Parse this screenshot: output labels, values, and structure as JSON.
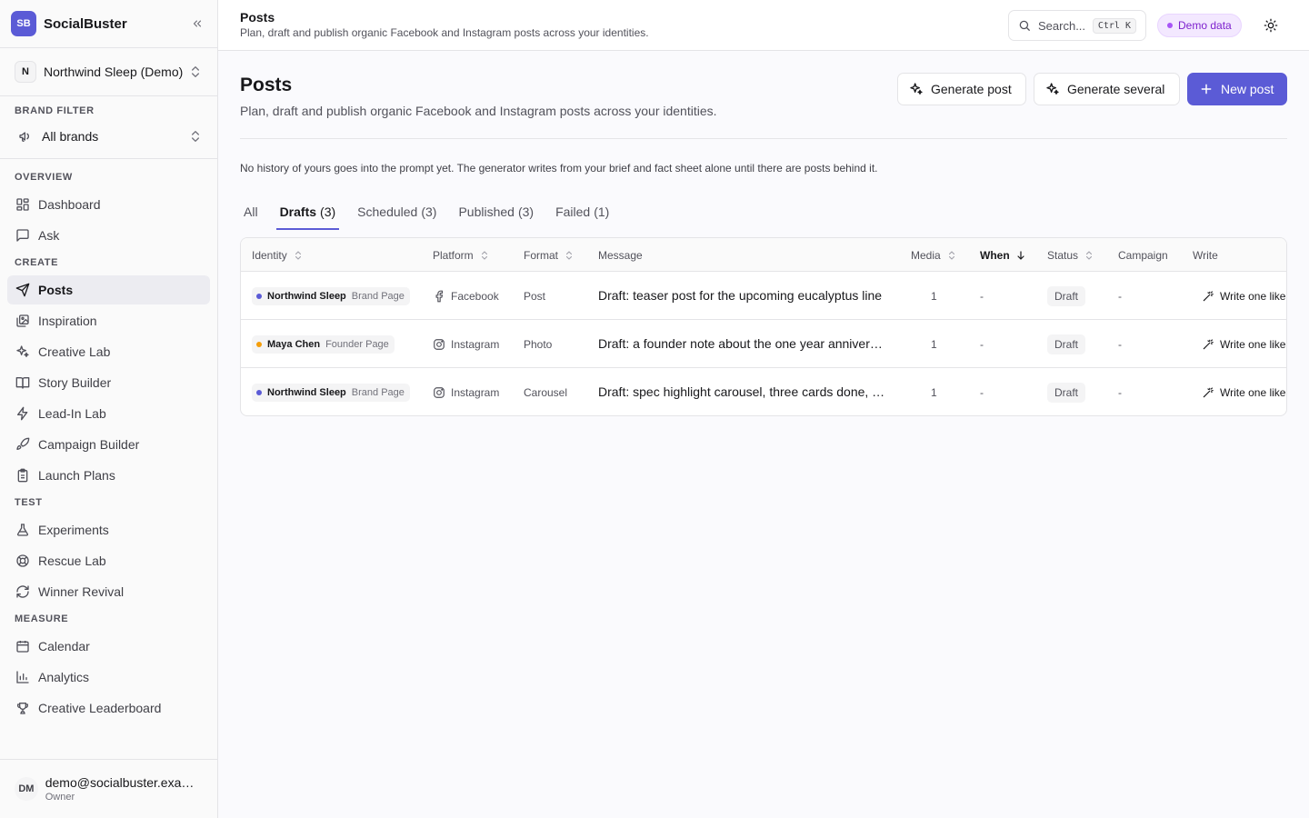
{
  "app": {
    "logo": "SB",
    "name": "SocialBuster"
  },
  "org": {
    "avatar": "N",
    "name": "Northwind Sleep (Demo)"
  },
  "brand_filter": {
    "label": "Brand filter",
    "value": "All brands"
  },
  "nav": {
    "overview": {
      "label": "Overview",
      "items": [
        {
          "label": "Dashboard",
          "icon": "dashboard-icon"
        },
        {
          "label": "Ask",
          "icon": "chat-icon"
        }
      ]
    },
    "create": {
      "label": "Create",
      "items": [
        {
          "label": "Posts",
          "icon": "send-icon"
        },
        {
          "label": "Inspiration",
          "icon": "gallery-icon"
        },
        {
          "label": "Creative Lab",
          "icon": "sparkles-icon"
        },
        {
          "label": "Story Builder",
          "icon": "book-icon"
        },
        {
          "label": "Lead-In Lab",
          "icon": "bolt-icon"
        },
        {
          "label": "Campaign Builder",
          "icon": "rocket-icon"
        },
        {
          "label": "Launch Plans",
          "icon": "clipboard-icon"
        }
      ]
    },
    "test": {
      "label": "Test",
      "items": [
        {
          "label": "Experiments",
          "icon": "flask-icon"
        },
        {
          "label": "Rescue Lab",
          "icon": "lifebuoy-icon"
        },
        {
          "label": "Winner Revival",
          "icon": "refresh-icon"
        }
      ]
    },
    "measure": {
      "label": "Measure",
      "items": [
        {
          "label": "Calendar",
          "icon": "calendar-icon"
        },
        {
          "label": "Analytics",
          "icon": "chart-icon"
        },
        {
          "label": "Creative Leaderboard",
          "icon": "trophy-icon"
        }
      ]
    }
  },
  "user": {
    "initials": "DM",
    "email": "demo@socialbuster.example",
    "role": "Owner"
  },
  "topbar": {
    "title": "Posts",
    "subtitle": "Plan, draft and publish organic Facebook and Instagram posts across your identities.",
    "search_placeholder": "Search...",
    "shortcut": "Ctrl K",
    "demo_badge": "Demo data"
  },
  "page": {
    "title": "Posts",
    "subtitle": "Plan, draft and publish organic Facebook and Instagram posts across your identities.",
    "buttons": {
      "generate_post": "Generate post",
      "generate_several": "Generate several",
      "new_post": "New post"
    },
    "notice": "No history of yours goes into the prompt yet. The generator writes from your brief and fact sheet alone until there are posts behind it."
  },
  "tabs": [
    {
      "label": "All",
      "count": ""
    },
    {
      "label": "Drafts",
      "count": "(3)"
    },
    {
      "label": "Scheduled",
      "count": "(3)"
    },
    {
      "label": "Published",
      "count": "(3)"
    },
    {
      "label": "Failed",
      "count": "(1)"
    }
  ],
  "table": {
    "columns": {
      "identity": "Identity",
      "platform": "Platform",
      "format": "Format",
      "message": "Message",
      "media": "Media",
      "when": "When",
      "status": "Status",
      "campaign": "Campaign",
      "write": "Write"
    },
    "rows": [
      {
        "identity": "Northwind Sleep",
        "identity_type": "Brand Page",
        "dot_color": "#5b5bd6",
        "platform": "Facebook",
        "platform_icon": "facebook-icon",
        "format": "Post",
        "message": "Draft: teaser post for the upcoming eucalyptus line",
        "media": "1",
        "when": "-",
        "status": "Draft",
        "campaign": "-",
        "write": "Write one like this"
      },
      {
        "identity": "Maya Chen",
        "identity_type": "Founder Page",
        "dot_color": "#f59e0b",
        "platform": "Instagram",
        "platform_icon": "instagram-icon",
        "format": "Photo",
        "message": "Draft: a founder note about the one year anniversary",
        "media": "1",
        "when": "-",
        "status": "Draft",
        "campaign": "-",
        "write": "Write one like this"
      },
      {
        "identity": "Northwind Sleep",
        "identity_type": "Brand Page",
        "dot_color": "#5b5bd6",
        "platform": "Instagram",
        "platform_icon": "instagram-icon",
        "format": "Carousel",
        "message": "Draft: spec highlight carousel, three cards done, one to go",
        "media": "1",
        "when": "-",
        "status": "Draft",
        "campaign": "-",
        "write": "Write one like this"
      }
    ]
  },
  "colors": {
    "accent": "#5b5bd6",
    "demo_badge_bg": "#f3e8ff",
    "demo_badge_text": "#7e22ce"
  }
}
